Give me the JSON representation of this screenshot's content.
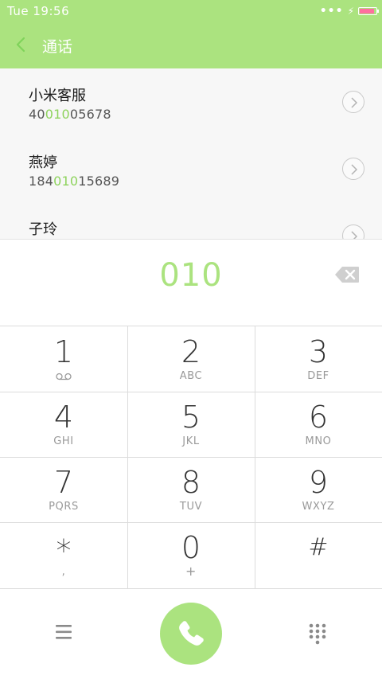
{
  "status_bar": {
    "time": "Tue 19:56",
    "battery_color": "#ff6f9f"
  },
  "header": {
    "title": "通话",
    "back_icon": "chevron-left-icon",
    "color": "#abe37f"
  },
  "contacts": [
    {
      "name": "小米客服",
      "number_prefix": "40",
      "number_match": "010",
      "number_suffix": "05678"
    },
    {
      "name": "燕婷",
      "number_prefix": "184",
      "number_match": "010",
      "number_suffix": "15689"
    },
    {
      "name": "子玲",
      "number_prefix": "",
      "number_match": "",
      "number_suffix": ""
    }
  ],
  "dialer": {
    "input_value": "010",
    "backspace_icon": "backspace-icon"
  },
  "keypad": {
    "keys": [
      {
        "digit": "1",
        "letters": ""
      },
      {
        "digit": "2",
        "letters": "ABC"
      },
      {
        "digit": "3",
        "letters": "DEF"
      },
      {
        "digit": "4",
        "letters": "GHI"
      },
      {
        "digit": "5",
        "letters": "JKL"
      },
      {
        "digit": "6",
        "letters": "MNO"
      },
      {
        "digit": "7",
        "letters": "PQRS"
      },
      {
        "digit": "8",
        "letters": "TUV"
      },
      {
        "digit": "9",
        "letters": "WXYZ"
      },
      {
        "digit": "*",
        "letters": ","
      },
      {
        "digit": "0",
        "letters": "+"
      },
      {
        "digit": "#",
        "letters": ""
      }
    ]
  },
  "bottom_bar": {
    "menu_icon": "menu-icon",
    "call_icon": "phone-icon",
    "keypad_toggle_icon": "dialpad-icon"
  }
}
